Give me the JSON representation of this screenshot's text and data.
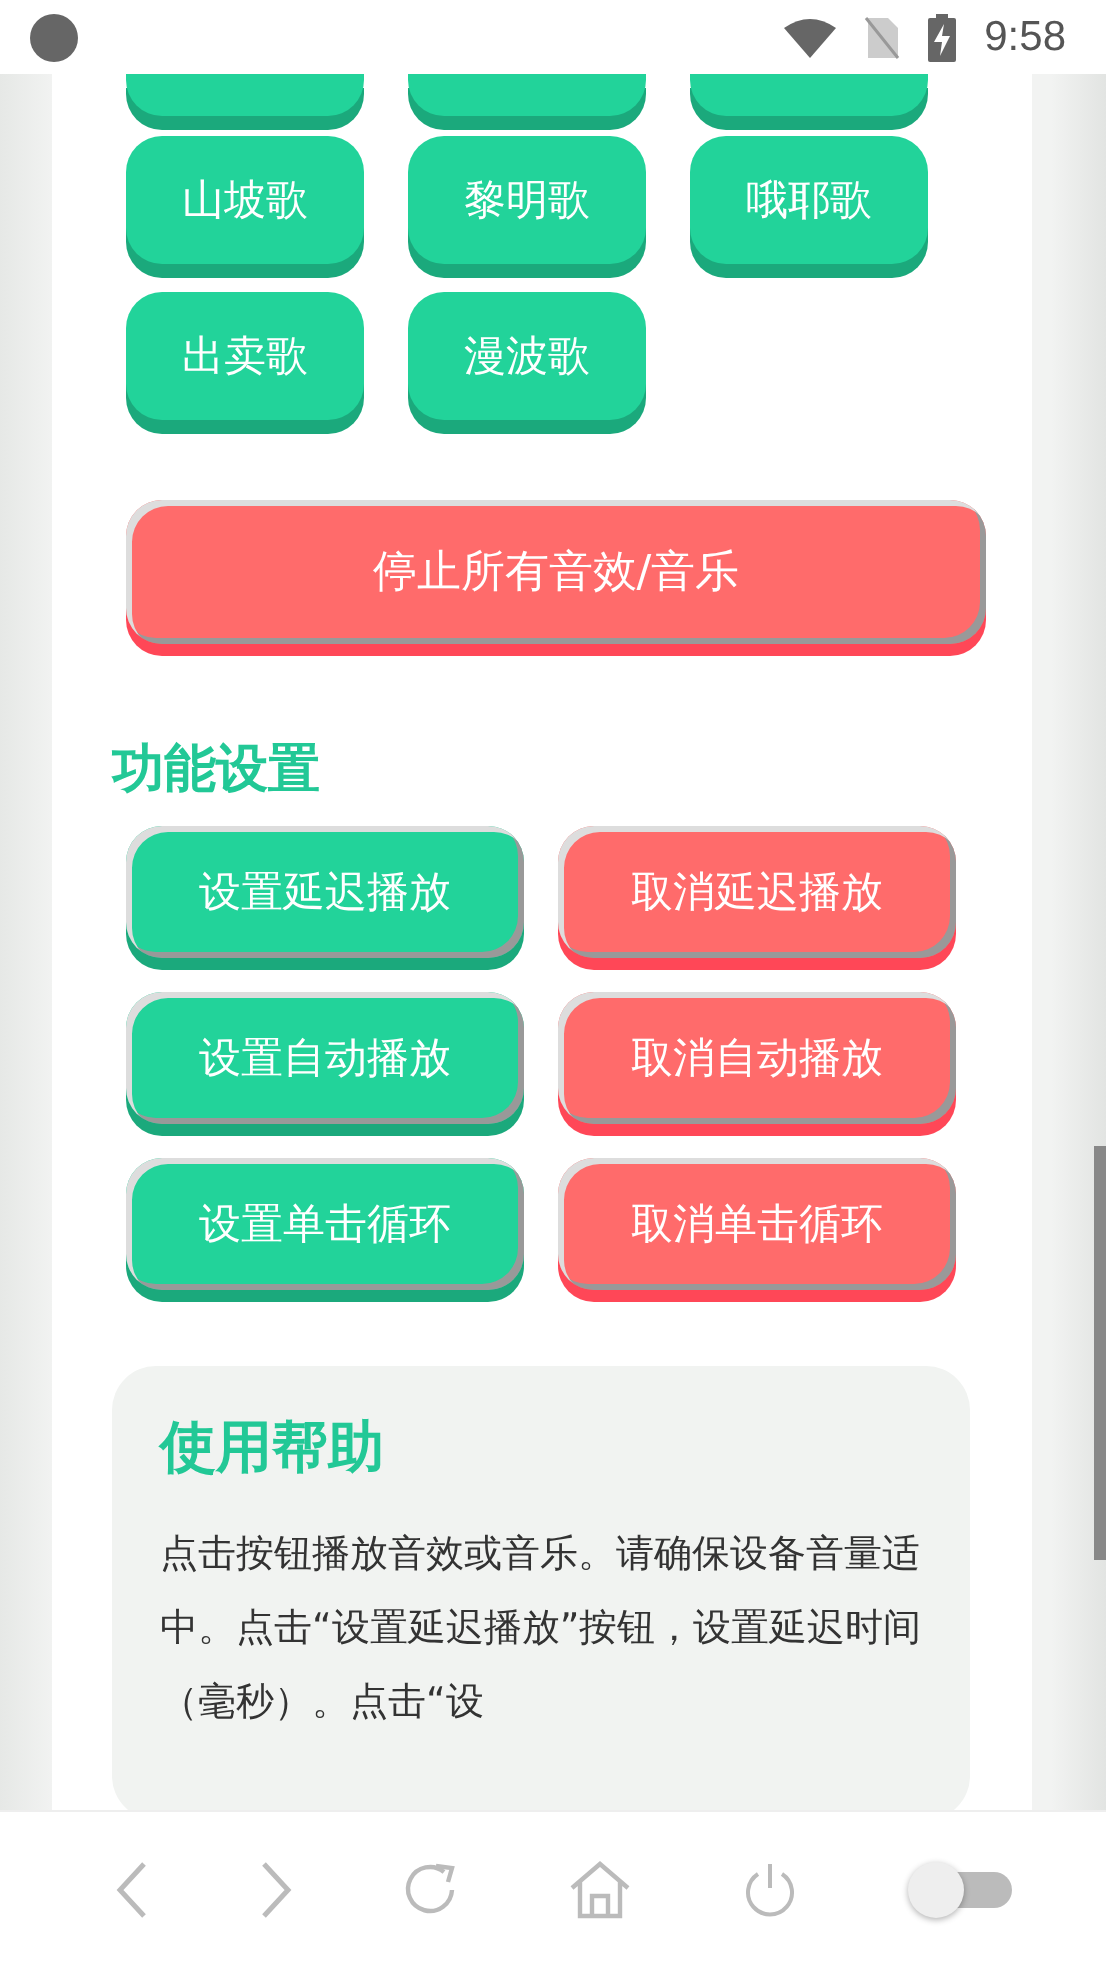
{
  "status_bar": {
    "time": "9:58"
  },
  "partial_row": [
    {
      "kind": "song"
    },
    {
      "kind": "song"
    },
    {
      "kind": "song"
    }
  ],
  "song_buttons": [
    {
      "label": "山坡歌"
    },
    {
      "label": "黎明歌"
    },
    {
      "label": "哦耶歌"
    },
    {
      "label": "出卖歌"
    },
    {
      "label": "漫波歌"
    }
  ],
  "stop_button": "停止所有音效/音乐",
  "settings": {
    "title": "功能设置",
    "buttons": [
      {
        "label": "设置延迟播放",
        "kind": "set"
      },
      {
        "label": "取消延迟播放",
        "kind": "cancel"
      },
      {
        "label": "设置自动播放",
        "kind": "set"
      },
      {
        "label": "取消自动播放",
        "kind": "cancel"
      },
      {
        "label": "设置单击循环",
        "kind": "set"
      },
      {
        "label": "取消单击循环",
        "kind": "cancel"
      }
    ]
  },
  "help": {
    "title": "使用帮助",
    "text": "点击按钮播放音效或音乐。请确保设备音量适中。点击“设置延迟播放”按钮，设置延迟时间（毫秒）。点击“设"
  },
  "bottom_bar": {
    "toggle": {
      "on": false
    }
  }
}
